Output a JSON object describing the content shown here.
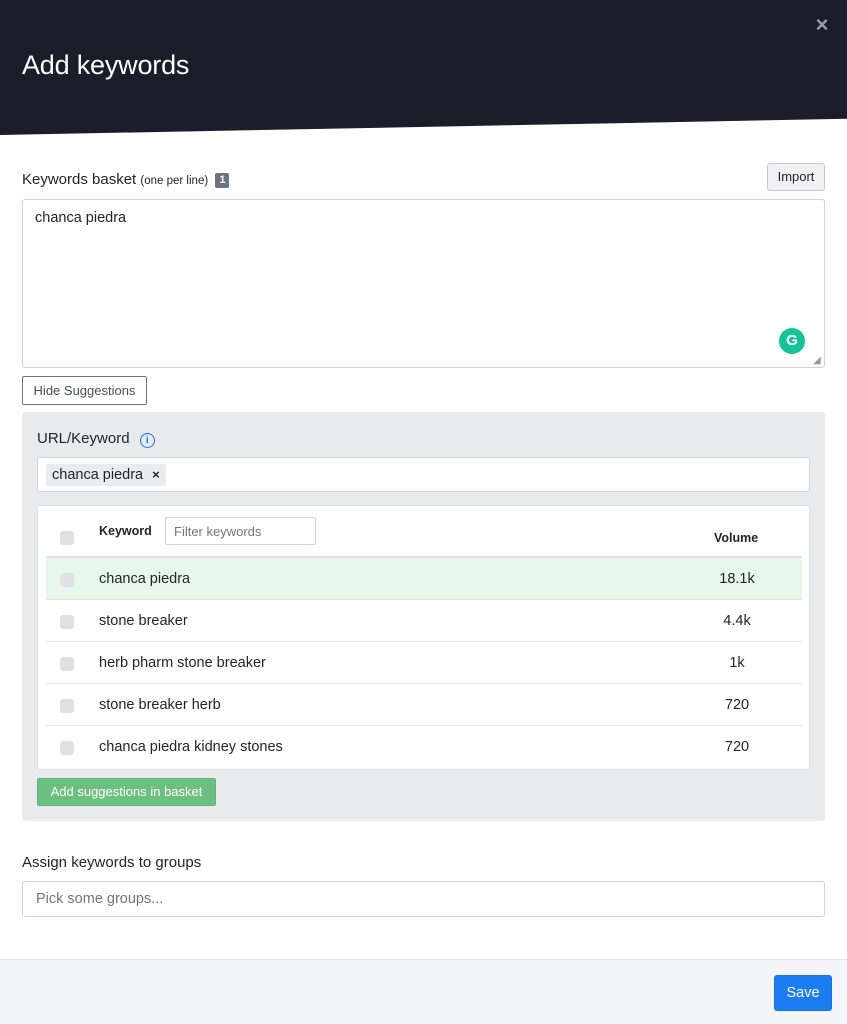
{
  "modal": {
    "title": "Add keywords",
    "close_icon": "×"
  },
  "basket": {
    "label": "Keywords basket",
    "hint": "(one per line)",
    "count": "1",
    "import_label": "Import",
    "textarea_value": "chanca piedra",
    "grammarly_icon": "grammarly-icon"
  },
  "suggestions": {
    "toggle_label": "Hide Suggestions",
    "url_label": "URL/Keyword",
    "info_icon": "i",
    "tag": "chanca piedra",
    "tag_remove": "×",
    "table": {
      "col_keyword": "Keyword",
      "filter_placeholder": "Filter keywords",
      "col_volume": "Volume",
      "rows": [
        {
          "keyword": "chanca piedra",
          "volume": "18.1k",
          "highlighted": true
        },
        {
          "keyword": "stone breaker",
          "volume": "4.4k",
          "highlighted": false
        },
        {
          "keyword": "herb pharm stone breaker",
          "volume": "1k",
          "highlighted": false
        },
        {
          "keyword": "stone breaker herb",
          "volume": "720",
          "highlighted": false
        },
        {
          "keyword": "chanca piedra kidney stones",
          "volume": "720",
          "highlighted": false
        }
      ]
    },
    "add_button_label": "Add suggestions in basket"
  },
  "groups": {
    "label": "Assign keywords to groups",
    "placeholder": "Pick some groups..."
  },
  "footer": {
    "save_label": "Save"
  },
  "colors": {
    "header_bg": "#1b1d2b",
    "primary": "#1e7cf2",
    "success": "#6cbf7f",
    "panel_bg": "#e8eaee",
    "highlight_row": "#e7f8ea",
    "grammarly": "#15c39a"
  }
}
